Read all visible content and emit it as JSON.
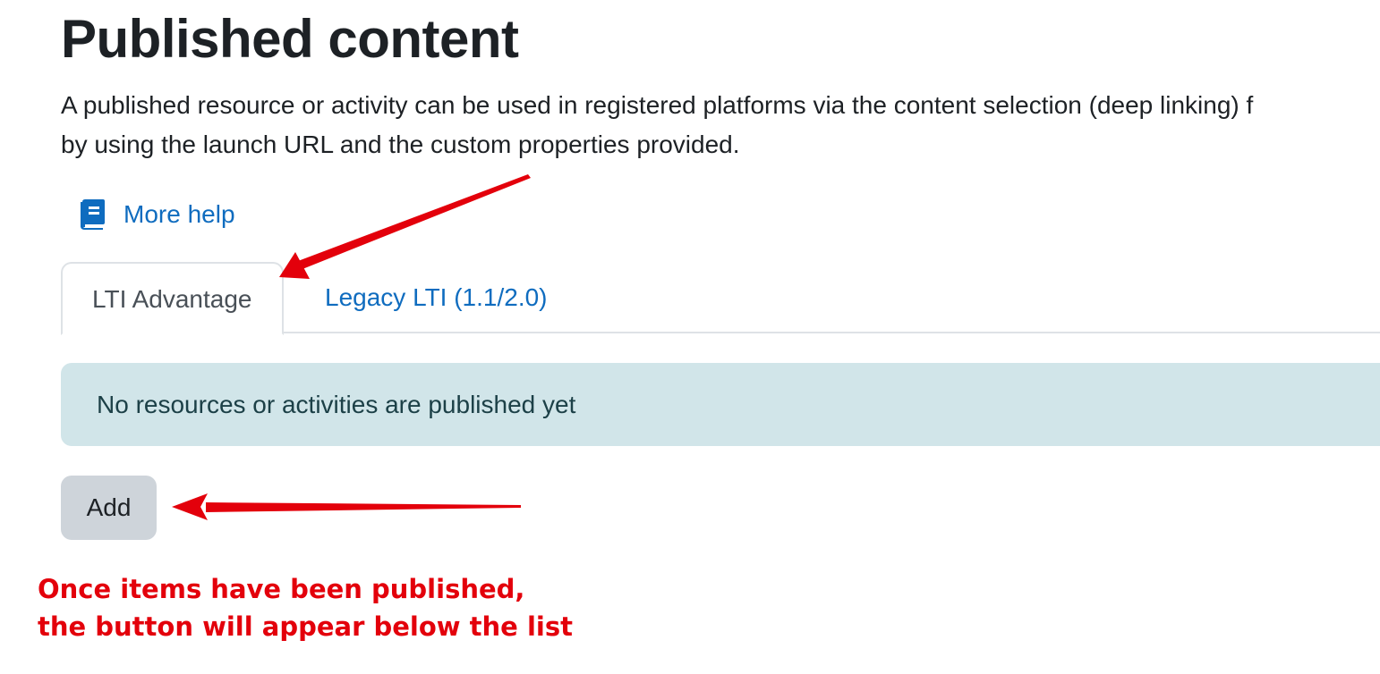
{
  "page": {
    "title": "Published content",
    "intro_lines": [
      "A published resource or activity can be used in registered platforms via the content selection (deep linking) f",
      "by using the launch URL and the custom properties provided."
    ]
  },
  "help": {
    "label": "More help",
    "icon": "book-icon"
  },
  "tabs": [
    {
      "label": "LTI Advantage",
      "active": true
    },
    {
      "label": "Legacy LTI (1.1/2.0)",
      "active": false
    }
  ],
  "alert": {
    "text": "No resources or activities are published yet"
  },
  "actions": {
    "add_label": "Add"
  },
  "annotation": {
    "lines": [
      "Once items have been published,",
      "the button will appear below the list"
    ]
  },
  "colors": {
    "link": "#0f6cbf",
    "alert_bg": "#d1e5e9",
    "button_bg": "#ced4da",
    "annotation_red": "#e3000b"
  }
}
